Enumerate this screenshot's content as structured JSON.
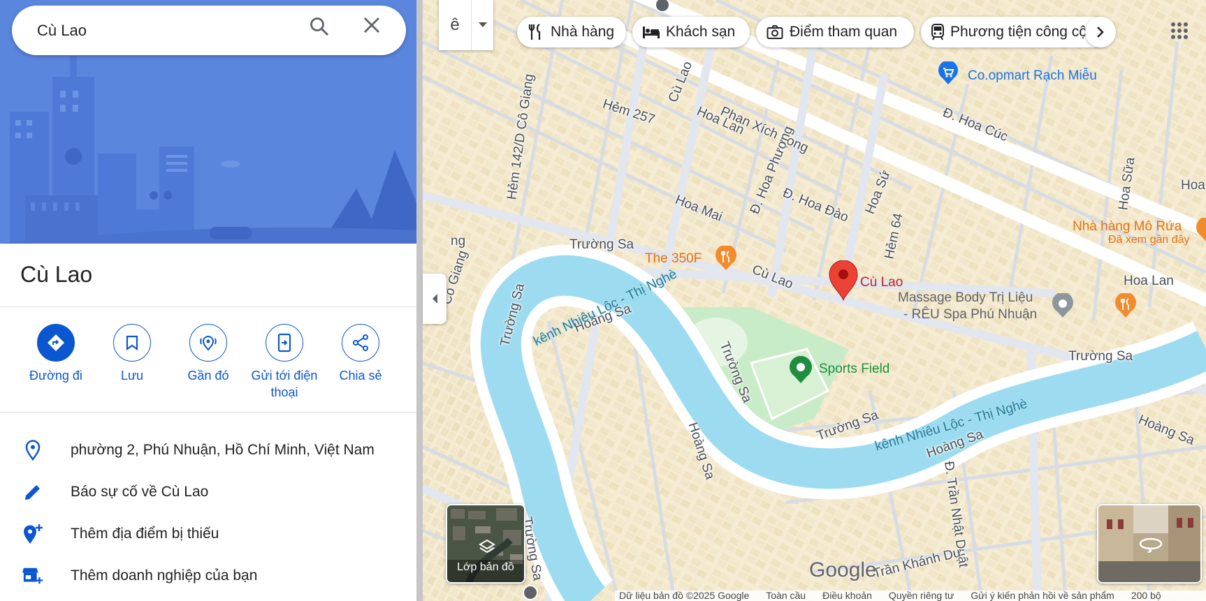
{
  "search": {
    "value": "Cù Lao"
  },
  "place": {
    "title": "Cù Lao",
    "actions": [
      {
        "label": "Đường đi",
        "icon": "directions-icon"
      },
      {
        "label": "Lưu",
        "icon": "bookmark-icon"
      },
      {
        "label": "Gần đó",
        "icon": "nearby-icon"
      },
      {
        "label": "Gửi tới điện thoại",
        "icon": "send-to-phone-icon"
      },
      {
        "label": "Chia sẻ",
        "icon": "share-icon"
      }
    ],
    "info_rows": [
      {
        "text": "phường 2, Phú Nhuận, Hồ Chí Minh, Việt Nam",
        "icon": "location-pin-icon"
      },
      {
        "text": "Báo sự cố về Cù Lao",
        "icon": "pencil-icon"
      },
      {
        "text": "Thêm địa điểm bị thiếu",
        "icon": "add-location-icon"
      },
      {
        "text": "Thêm doanh nghiệp của bạn",
        "icon": "add-business-icon"
      }
    ]
  },
  "map": {
    "ime_label": "ê",
    "chips": [
      {
        "label": "Nhà hàng",
        "icon": "restaurant-icon"
      },
      {
        "label": "Khách sạn",
        "icon": "hotel-icon"
      },
      {
        "label": "Điểm tham quan",
        "icon": "camera-icon"
      },
      {
        "label": "Phương tiện công cộng",
        "icon": "transit-icon"
      }
    ],
    "roads": [
      "Phan Xích Long",
      "Hoa Lan",
      "Hẻm 257",
      "Cù Lao",
      "Cù Lao",
      "Hẻm 142/D Cô Giang",
      "Đ. Hoa Phượng",
      "Hoa Mai",
      "Đ. Hoa Đào",
      "Hoa Sứ",
      "Hẻm 64",
      "Đ. Hoa Cúc",
      "Hoa Sữa",
      "Hoa",
      "Trường Sa",
      "Trường Sa",
      "Trường Sa",
      "Trường Sa",
      "Trường Sa",
      "Trường Sa",
      "Hoàng Sa",
      "Hoàng Sa",
      "Hoàng Sa",
      "Hoàng Sa",
      "Đ. Trần Nhật Duật",
      "Trần Khánh Dư",
      "Hoa Lan",
      "Cô Giang",
      "Trường Sa",
      "ng"
    ],
    "water": [
      "kênh Nhiêu Lộc - Thị Nghè",
      "kênh Nhiêu Lộc - Thị Nghè"
    ],
    "pois": {
      "coopmart": "Co.opmart Rạch Miễu",
      "restaurant_350f": "The 350F",
      "selected_pin": "Cù Lao",
      "massage_line1": "Massage Body Trị Liệu",
      "massage_line2": "- RÊU Spa Phú Nhuận",
      "sports_field": "Sports Field",
      "mo_rua": "Nhà hàng Mô Rứa",
      "mo_rua_sub": "Đã xem gần đây"
    },
    "layers_label": "Lớp bản đồ",
    "google_logo": "Google",
    "footer": [
      "Dữ liệu bản đồ ©2025 Google",
      "Toàn cầu",
      "Điều khoản",
      "Quyền riêng tư",
      "Gửi ý kiến phản hồi về sản phẩm",
      "200 bộ"
    ],
    "colors": {
      "water": "#9ddcf0",
      "park": "#c5ecc7",
      "road": "#ffffff",
      "pin": "#ea4335",
      "restaurant": "#f28b2c",
      "link": "#1a73e8",
      "accent": "#0b57d0"
    }
  }
}
